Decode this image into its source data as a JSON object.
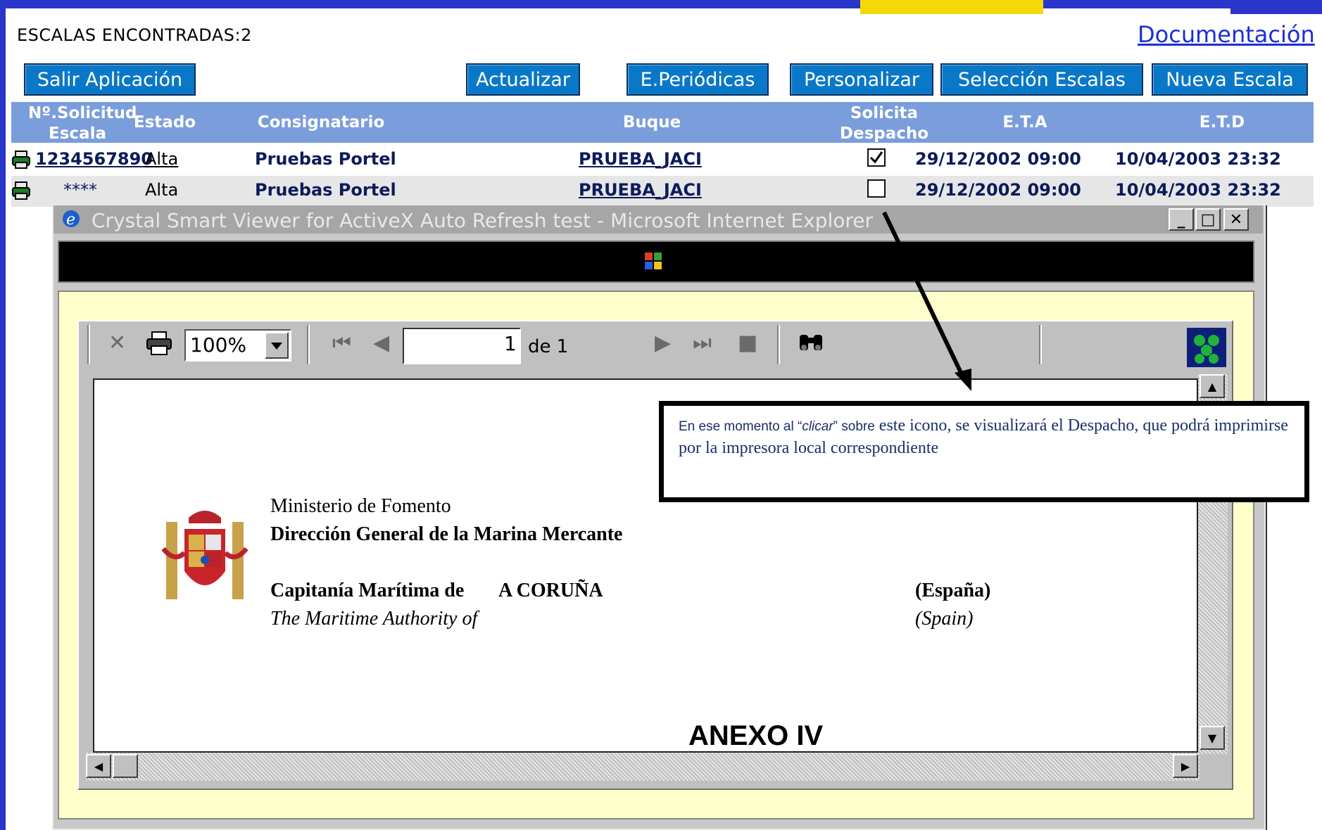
{
  "header": {
    "count_label": "ESCALAS ENCONTRADAS:2",
    "doc_link": "Documentación"
  },
  "buttons": {
    "salir": "Salir Aplicación",
    "actualizar": "Actualizar",
    "periodicas": "E.Periódicas",
    "personalizar": "Personalizar",
    "seleccion": "Selección Escalas",
    "nueva": "Nueva Escala"
  },
  "table": {
    "headers": {
      "solicitud_1": "Nº.Solicitud",
      "solicitud_2": "Escala",
      "estado": "Estado",
      "consignatario": "Consignatario",
      "buque": "Buque",
      "despacho_1": "Solicita",
      "despacho_2": "Despacho",
      "eta": "E.T.A",
      "etd": "E.T.D"
    },
    "rows": [
      {
        "solicitud": "1234567890",
        "estado": "Alta",
        "consignatario": "Pruebas Portel",
        "buque": "PRUEBA_JACI",
        "despacho": true,
        "eta": "29/12/2002  09:00",
        "etd": "10/04/2003  23:32"
      },
      {
        "solicitud": "****",
        "estado": "Alta",
        "consignatario": "Pruebas Portel",
        "buque": "PRUEBA_JACI",
        "despacho": false,
        "eta": "29/12/2002  09:00",
        "etd": "10/04/2003  23:32"
      }
    ]
  },
  "ie_window": {
    "title": "Crystal Smart Viewer for ActiveX Auto Refresh test - Microsoft Internet Explorer",
    "minimize": "_",
    "maximize": "□",
    "close": "✕"
  },
  "viewer": {
    "zoom": "100%",
    "page": "1",
    "page_of": "de 1"
  },
  "document": {
    "line1": "Ministerio de Fomento",
    "line2": "Dirección General de la Marina Mercante",
    "capitania": "Capitanía Marítima de",
    "city": "A CORUÑA",
    "country": "(España)",
    "maritime": "The Maritime Authority of",
    "country_en": "(Spain)",
    "annex": "ANEXO IV"
  },
  "callout": {
    "part1": "En ese momento al “",
    "part2": "clicar",
    "part3": "” sobre",
    "part4": " este icono, se visualizará el Despacho, que podrá imprimirse por la impresora local correspondiente"
  },
  "colors": {
    "frame": "#2a35c9",
    "button": "#0a78c8",
    "table_header": "#7a9ddc",
    "page_bg": "#ffffcc"
  }
}
